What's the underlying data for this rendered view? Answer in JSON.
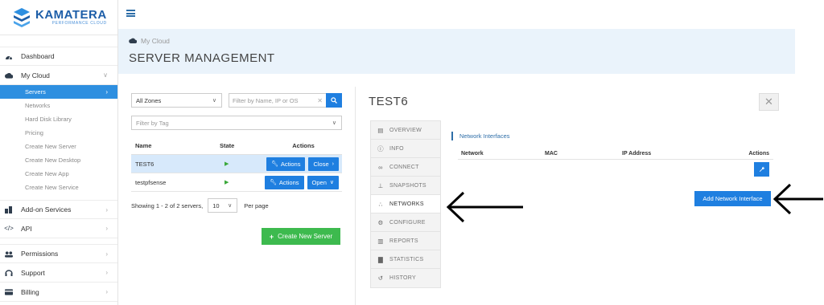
{
  "brand": {
    "name": "KAMATERA",
    "tagline": "PERFORMANCE CLOUD"
  },
  "sidebar": {
    "items": [
      {
        "label": "Dashboard",
        "icon": "dashboard-icon"
      },
      {
        "label": "My Cloud",
        "icon": "cloud-icon"
      }
    ],
    "cloud_sub": [
      {
        "label": "Servers",
        "active": true
      },
      {
        "label": "Networks"
      },
      {
        "label": "Hard Disk Library"
      },
      {
        "label": "Pricing"
      },
      {
        "label": "Create New Server"
      },
      {
        "label": "Create New Desktop"
      },
      {
        "label": "Create New App"
      },
      {
        "label": "Create New Service"
      }
    ],
    "more": [
      {
        "label": "Add-on Services",
        "icon": "addon-icon"
      },
      {
        "label": "API",
        "icon": "code-icon"
      },
      {
        "label": "Permissions",
        "icon": "users-icon"
      },
      {
        "label": "Support",
        "icon": "headset-icon"
      },
      {
        "label": "Billing",
        "icon": "card-icon"
      }
    ]
  },
  "header": {
    "breadcrumb": "My Cloud",
    "title": "SERVER MANAGEMENT"
  },
  "list": {
    "zone_select": "All Zones",
    "filter_placeholder": "Filter by Name, IP or OS",
    "tag_placeholder": "Filter by Tag",
    "columns": [
      "Name",
      "State",
      "Actions"
    ],
    "rows": [
      {
        "name": "TEST6",
        "action": "Actions",
        "toggle": "Close",
        "selected": true
      },
      {
        "name": "testpfsense",
        "action": "Actions",
        "toggle": "Open",
        "selected": false
      }
    ],
    "showing": "Showing 1 - 2 of 2 servers,",
    "per_page_value": "10",
    "per_page_label": "Per page",
    "create_label": "Create New Server"
  },
  "detail": {
    "title": "TEST6",
    "tabs": [
      {
        "label": "OVERVIEW",
        "icon": "file-icon"
      },
      {
        "label": "INFO",
        "icon": "info-icon"
      },
      {
        "label": "CONNECT",
        "icon": "link-icon"
      },
      {
        "label": "SNAPSHOTS",
        "icon": "pin-icon"
      },
      {
        "label": "NETWORKS",
        "icon": "network-icon",
        "active": true
      },
      {
        "label": "CONFIGURE",
        "icon": "cogs-icon"
      },
      {
        "label": "REPORTS",
        "icon": "report-icon"
      },
      {
        "label": "STATISTICS",
        "icon": "chart-icon"
      },
      {
        "label": "HISTORY",
        "icon": "history-icon"
      }
    ],
    "section_title": "Network Interfaces",
    "columns": [
      "Network",
      "MAC",
      "IP Address",
      "Actions"
    ],
    "add_label": "Add Network Interface"
  },
  "colors": {
    "primary": "#1f7fe0",
    "success": "#3dba4e",
    "header_bg": "#eaf3fb"
  }
}
